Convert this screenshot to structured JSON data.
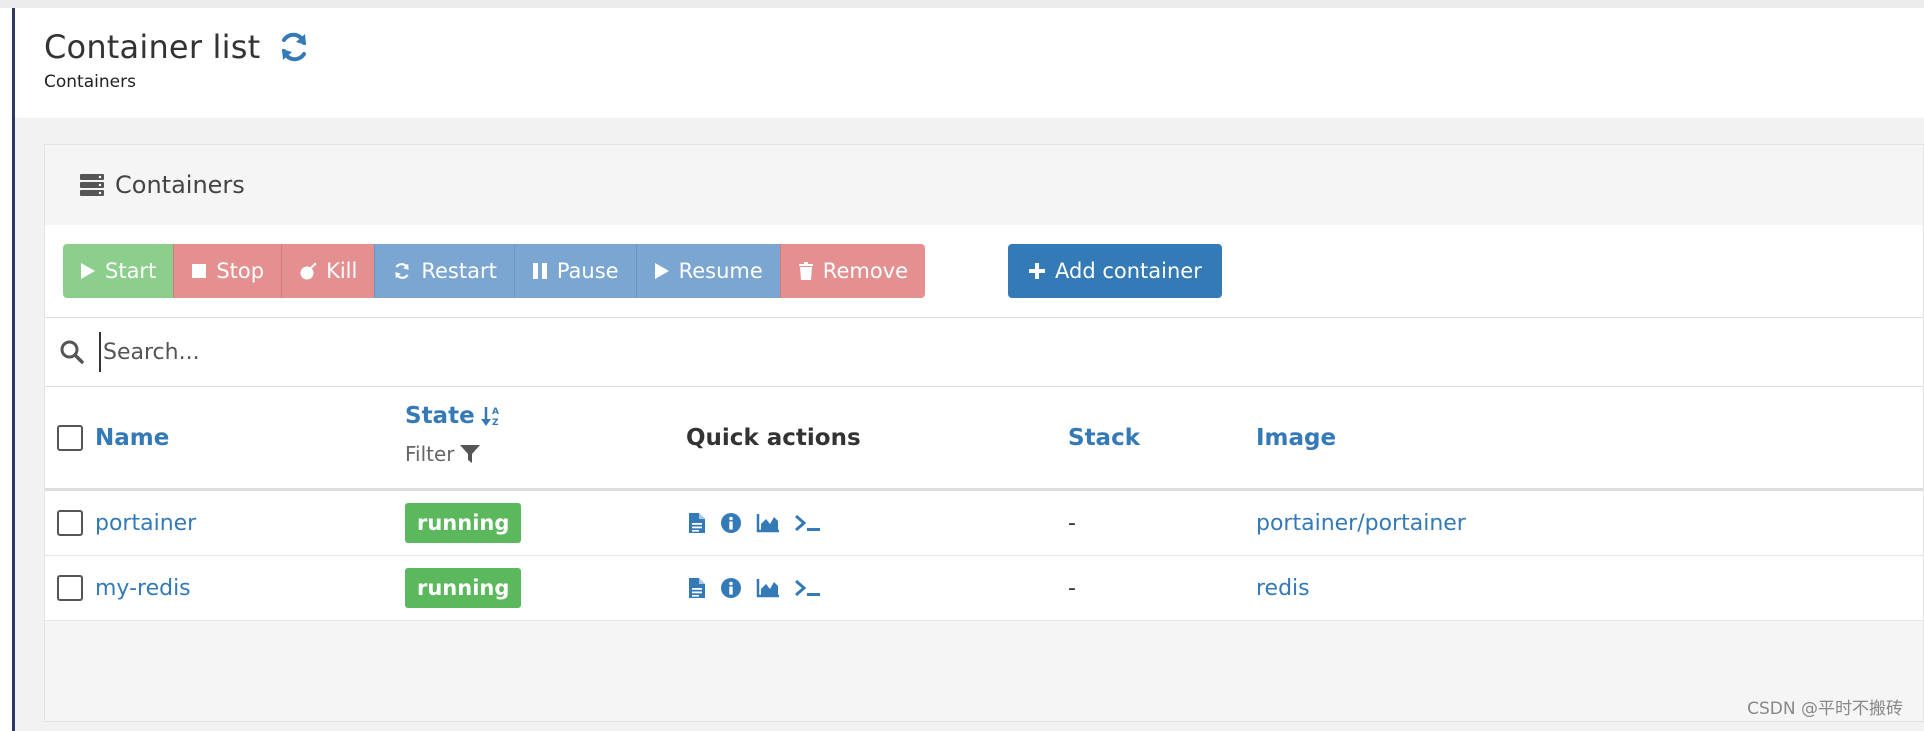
{
  "header": {
    "title": "Container list",
    "breadcrumb": "Containers"
  },
  "panel": {
    "title": "Containers"
  },
  "toolbar": {
    "start": "Start",
    "stop": "Stop",
    "kill": "Kill",
    "restart": "Restart",
    "pause": "Pause",
    "resume": "Resume",
    "remove": "Remove",
    "add": "Add container"
  },
  "search": {
    "placeholder": "Search...",
    "value": ""
  },
  "table": {
    "columns": {
      "name": "Name",
      "state": "State",
      "state_filter": "Filter",
      "quick_actions": "Quick actions",
      "stack": "Stack",
      "image": "Image"
    },
    "rows": [
      {
        "name": "portainer",
        "state": "running",
        "stack": "-",
        "image": "portainer/portainer"
      },
      {
        "name": "my-redis",
        "state": "running",
        "stack": "-",
        "image": "redis"
      }
    ]
  },
  "watermark": "CSDN @平时不搬砖",
  "colors": {
    "link": "#337ab7",
    "running": "#5cb85c",
    "start": "#8ccf8c",
    "danger": "#e59090",
    "info": "#7aa6d1",
    "primary": "#337ab7",
    "sidebar_edge": "#2d3a69"
  },
  "icons": [
    "refresh-icon",
    "server-icon",
    "play-icon",
    "stop-icon",
    "bomb-icon",
    "refresh-icon",
    "pause-icon",
    "play-icon",
    "trash-icon",
    "plus-icon",
    "search-icon",
    "sort-icon",
    "filter-icon",
    "file-icon",
    "info-icon",
    "chart-icon",
    "terminal-icon"
  ]
}
